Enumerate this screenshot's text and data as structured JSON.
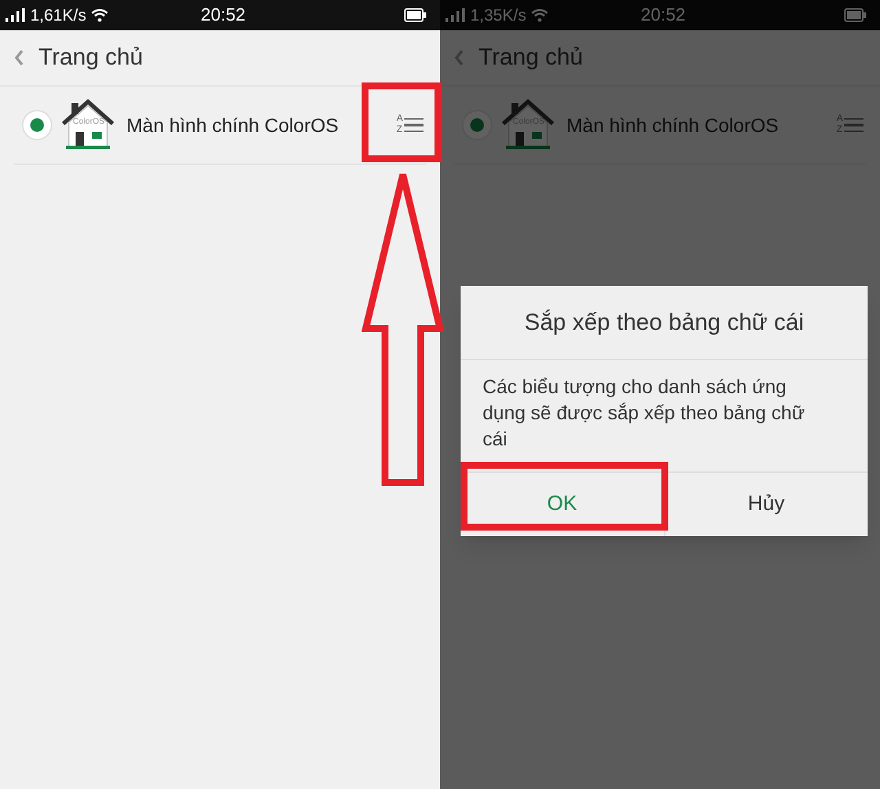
{
  "screens": [
    {
      "status_bar": {
        "speed": "1,61K/s",
        "time": "20:52"
      },
      "header": {
        "title": "Trang chủ"
      },
      "items": [
        {
          "label": "Màn hình chính ColorOS",
          "icon_text": "ColorOS",
          "selected": true
        }
      ],
      "sort_icon": {
        "top": "A",
        "bottom": "Z"
      }
    },
    {
      "status_bar": {
        "speed": "1,35K/s",
        "time": "20:52"
      },
      "header": {
        "title": "Trang chủ"
      },
      "items": [
        {
          "label": "Màn hình chính ColorOS",
          "icon_text": "ColorOS",
          "selected": true
        }
      ],
      "sort_icon": {
        "top": "A",
        "bottom": "Z"
      },
      "dialog": {
        "title": "Sắp xếp theo bảng chữ cái",
        "message": "Các biểu tượng cho danh sách ứng dụng sẽ được sắp xếp theo bảng chữ cái",
        "buttons": [
          {
            "label": "OK",
            "kind": "primary"
          },
          {
            "label": "Hủy",
            "kind": "secondary"
          }
        ]
      }
    }
  ],
  "annotations": [
    {
      "kind": "box"
    },
    {
      "kind": "arrow"
    },
    {
      "kind": "box"
    }
  ]
}
